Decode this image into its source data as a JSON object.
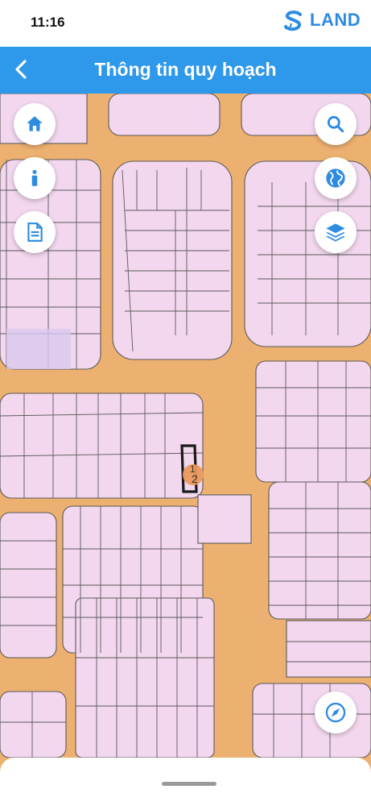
{
  "status_bar": {
    "time": "11:16"
  },
  "brand": {
    "logo_text": "LAND"
  },
  "header": {
    "title": "Thông tin quy hoạch"
  },
  "map": {
    "plot_labels": [
      "1",
      "2"
    ],
    "colors": {
      "land": "#f2d7ee",
      "road": "#ecb070",
      "selected": "#1a1a1a",
      "marker": "#e9995a"
    }
  },
  "left_controls": [
    "home-icon",
    "info-icon",
    "document-icon"
  ],
  "right_controls": [
    "search-icon",
    "globe-icon",
    "layers-icon"
  ],
  "bottom_control": "compass-icon"
}
